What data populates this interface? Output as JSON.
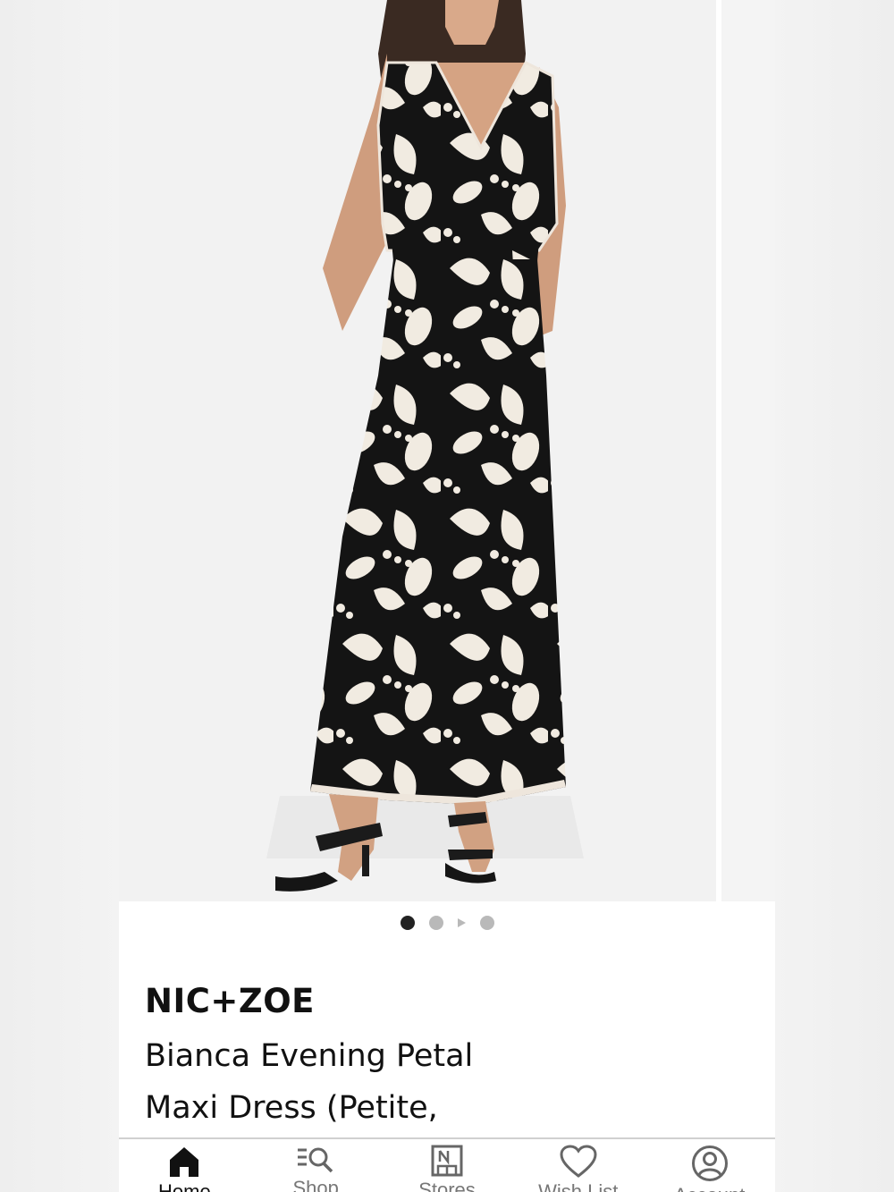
{
  "carousel": {
    "slide_count": 3,
    "active_index": 0,
    "image_alt": "Model wearing black and ivory petal print sleeveless maxi dress with black heeled sandals"
  },
  "product": {
    "brand": "NIC+ZOE",
    "name": "Bianca Evening Petal Maxi Dress (Petite,"
  },
  "tabbar": {
    "tabs": [
      {
        "label": "Home",
        "icon": "home-icon",
        "active": true
      },
      {
        "label": "Shop",
        "icon": "search-list-icon",
        "active": false
      },
      {
        "label": "Stores",
        "icon": "store-icon",
        "active": false
      },
      {
        "label": "Wish List",
        "icon": "heart-icon",
        "active": false
      },
      {
        "label": "Account",
        "icon": "account-icon",
        "active": false
      }
    ]
  },
  "colors": {
    "background": "#ffffff",
    "text": "#111111",
    "muted": "#777777",
    "dot_active": "#222222",
    "dot_inactive": "#b9b9b9"
  }
}
